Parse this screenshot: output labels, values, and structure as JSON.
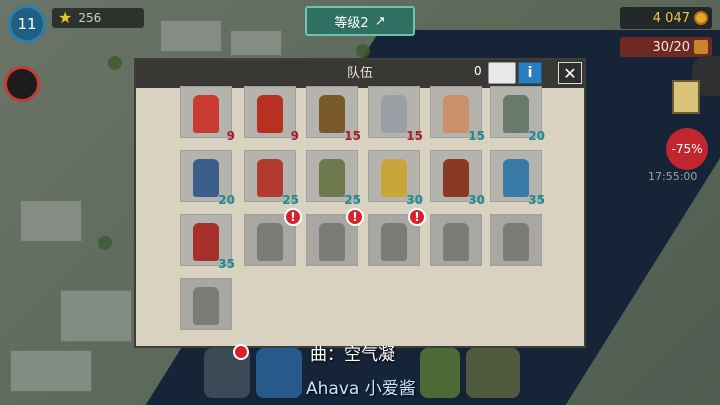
{
  "hud": {
    "player_level": "11",
    "star_count": "256",
    "level_up_label": "等级2",
    "coins": "4 047",
    "population": "30/20",
    "sale_badge": "-75%",
    "sale_timer": "17:55:00"
  },
  "panel": {
    "title": "队伍",
    "card_count": "0",
    "info_label": "i",
    "close_label": "✕"
  },
  "roster": [
    {
      "type": "medkit",
      "count": "9",
      "count_color": "red",
      "locked": false
    },
    {
      "type": "fuel-barrel",
      "count": "9",
      "count_color": "red",
      "locked": false
    },
    {
      "type": "molotov",
      "count": "15",
      "count_color": "red",
      "locked": false
    },
    {
      "type": "gas-canister",
      "count": "15",
      "count_color": "red",
      "locked": false
    },
    {
      "type": "shirtless-fighter",
      "count": "15",
      "count_color": "teal",
      "locked": false
    },
    {
      "type": "sniper",
      "count": "20",
      "count_color": "teal",
      "locked": false
    },
    {
      "type": "flamethrower-soldier",
      "count": "20",
      "count_color": "teal",
      "locked": false
    },
    {
      "type": "red-cap-survivor",
      "count": "25",
      "count_color": "teal",
      "locked": false
    },
    {
      "type": "green-cap-gunner",
      "count": "25",
      "count_color": "teal",
      "locked": false
    },
    {
      "type": "helmet-soldier",
      "count": "30",
      "count_color": "teal",
      "locked": false
    },
    {
      "type": "firefighter",
      "count": "30",
      "count_color": "teal",
      "locked": false
    },
    {
      "type": "blue-cap-shooter",
      "count": "35",
      "count_color": "teal",
      "locked": false
    },
    {
      "type": "lumberjack",
      "count": "35",
      "count_color": "teal",
      "locked": false
    },
    {
      "type": "police-officer",
      "count": "",
      "count_color": "teal",
      "locked": true,
      "alert": true
    },
    {
      "type": "soldier",
      "count": "",
      "count_color": "teal",
      "locked": true,
      "alert": true
    },
    {
      "type": "heavy-gunner",
      "count": "",
      "count_color": "teal",
      "locked": true,
      "alert": true
    },
    {
      "type": "commando",
      "count": "",
      "count_color": "teal",
      "locked": true,
      "alert": false
    },
    {
      "type": "riot-trooper",
      "count": "",
      "count_color": "teal",
      "locked": true,
      "alert": false
    },
    {
      "type": "chainsaw-maniac",
      "count": "",
      "count_color": "teal",
      "locked": true,
      "alert": false
    }
  ],
  "subtitles": {
    "line1": "曲：空气凝",
    "line2": "词：Ahava 小爱酱"
  },
  "colors": {
    "panel_bg": "#d9d2c1",
    "header_bg": "#3a3835",
    "teal_count": "#1e8c92",
    "red_count": "#a4202a",
    "alert_red": "#d8212a",
    "info_blue": "#2a7fc0"
  }
}
